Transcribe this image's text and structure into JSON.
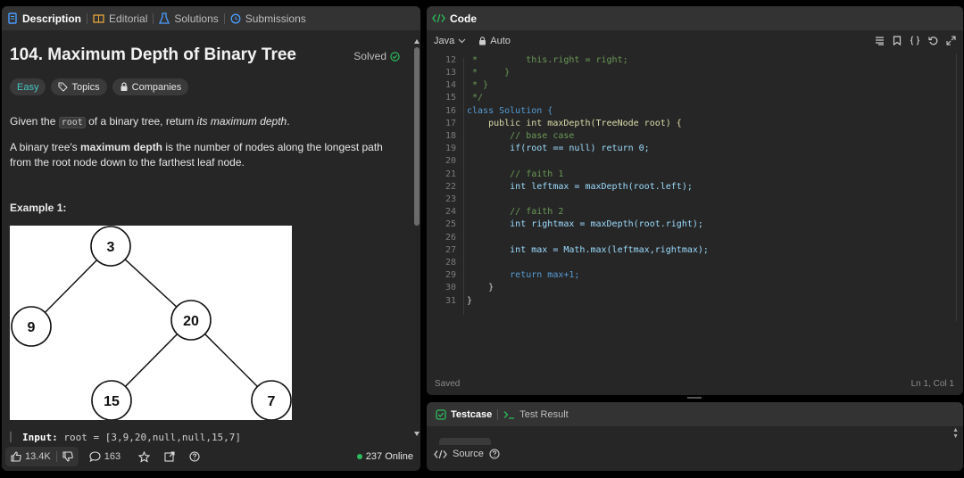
{
  "left_tabs": [
    {
      "label": "Description",
      "icon": "description-icon",
      "active": true
    },
    {
      "label": "Editorial",
      "icon": "book-icon",
      "active": false
    },
    {
      "label": "Solutions",
      "icon": "flask-icon",
      "active": false
    },
    {
      "label": "Submissions",
      "icon": "history-icon",
      "active": false
    }
  ],
  "problem": {
    "title": "104. Maximum Depth of Binary Tree",
    "solved": "Solved",
    "difficulty": "Easy",
    "topics": "Topics",
    "companies": "Companies",
    "p1_a": "Given the ",
    "p1_code": "root",
    "p1_b": " of a binary tree, return ",
    "p1_em": "its maximum depth",
    "p1_c": ".",
    "p2_a": "A binary tree's ",
    "p2_b": "maximum depth",
    "p2_c": " is the number of nodes along the longest path from the root node down to the farthest leaf node.",
    "example_label": "Example 1:",
    "tree_nodes": [
      "3",
      "9",
      "20",
      "15",
      "7"
    ],
    "input_label": "Input:",
    "input_value": "root = [3,9,20,null,null,15,7]"
  },
  "footer": {
    "likes": "13.4K",
    "comments": "163",
    "online": "237 Online"
  },
  "code_panel": {
    "title": "Code",
    "language": "Java",
    "mode": "Auto",
    "status": "Saved",
    "cursor": "Ln 1, Col 1",
    "lines": [
      {
        "n": "12",
        "t": " *         this.right = right;"
      },
      {
        "n": "13",
        "t": " *     }"
      },
      {
        "n": "14",
        "t": " * }"
      },
      {
        "n": "15",
        "t": " */"
      },
      {
        "n": "16",
        "t": "class Solution {"
      },
      {
        "n": "17",
        "t": "    public int maxDepth(TreeNode root) {"
      },
      {
        "n": "18",
        "t": "        // base case"
      },
      {
        "n": "19",
        "t": "        if(root == null) return 0;"
      },
      {
        "n": "20",
        "t": ""
      },
      {
        "n": "21",
        "t": "        // faith 1"
      },
      {
        "n": "22",
        "t": "        int leftmax = maxDepth(root.left);"
      },
      {
        "n": "23",
        "t": ""
      },
      {
        "n": "24",
        "t": "        // faith 2"
      },
      {
        "n": "25",
        "t": "        int rightmax = maxDepth(root.right);"
      },
      {
        "n": "26",
        "t": ""
      },
      {
        "n": "27",
        "t": "        int max = Math.max(leftmax,rightmax);"
      },
      {
        "n": "28",
        "t": ""
      },
      {
        "n": "29",
        "t": "        return max+1;"
      },
      {
        "n": "30",
        "t": "    }"
      },
      {
        "n": "31",
        "t": "}"
      }
    ]
  },
  "bottom_panel": {
    "tab_testcase": "Testcase",
    "tab_result": "Test Result",
    "source": "Source"
  },
  "colors": {
    "accent_green": "#2cbb5d",
    "easy_teal": "#46c6c2",
    "keyword_blue": "#569cd6",
    "comment_green": "#6a9955"
  }
}
